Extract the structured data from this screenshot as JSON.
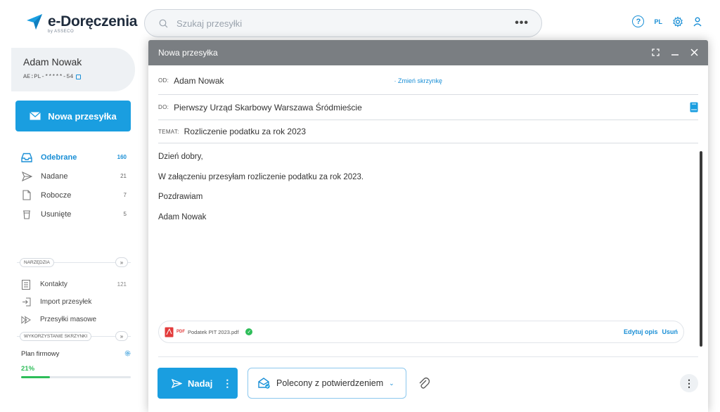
{
  "app": {
    "logo_text": "e-Doręczenia",
    "logo_sub": "by ASSECO"
  },
  "search": {
    "placeholder": "Szukaj przesyłki",
    "more": "•••"
  },
  "header": {
    "help": "?",
    "lang": "PL"
  },
  "user": {
    "name": "Adam Nowak",
    "address": "AE:PL-*****-54"
  },
  "sidebar": {
    "new_label": "Nowa przesyłka",
    "items": [
      {
        "label": "Odebrane",
        "count": "160"
      },
      {
        "label": "Nadane",
        "count": "21"
      },
      {
        "label": "Robocze",
        "count": "7"
      },
      {
        "label": "Usunięte",
        "count": "5"
      }
    ],
    "tools_header": "NARZĘDZIA",
    "tools": [
      {
        "label": "Kontakty",
        "count": "121"
      },
      {
        "label": "Import przesyłek",
        "count": ""
      },
      {
        "label": "Przesyłki masowe",
        "count": ""
      }
    ],
    "usage_header": "WYKORZYSTANIE SKRZYNKI",
    "plan_label": "Plan firmowy",
    "plan_percent_text": "21%",
    "plan_percent": 0.21
  },
  "compose": {
    "title": "Nowa przesyłka",
    "from_key": "OD:",
    "from_value": "Adam Nowak",
    "change_box": "· Zmień skrzynkę",
    "to_key": "DO:",
    "to_value": "Pierwszy Urząd Skarbowy Warszawa Śródmieście",
    "subject_key": "TEMAT:",
    "subject_value": "Rozliczenie podatku za rok 2023",
    "body": [
      "Dzień dobry,",
      "W załączeniu przesyłam rozliczenie podatku za rok 2023.",
      "Pozdrawiam",
      "Adam Nowak"
    ],
    "attachment": {
      "type": "PDF",
      "filename": "Podatek PIT 2023.pdf",
      "edit": "Edytuj opis",
      "remove": "Usuń"
    },
    "send_label": "Nadaj",
    "type_label": "Polecony z potwierdzeniem"
  },
  "colors": {
    "accent": "#1a9ee0",
    "success": "#2ebd59",
    "titlebar": "#7a7e82"
  }
}
